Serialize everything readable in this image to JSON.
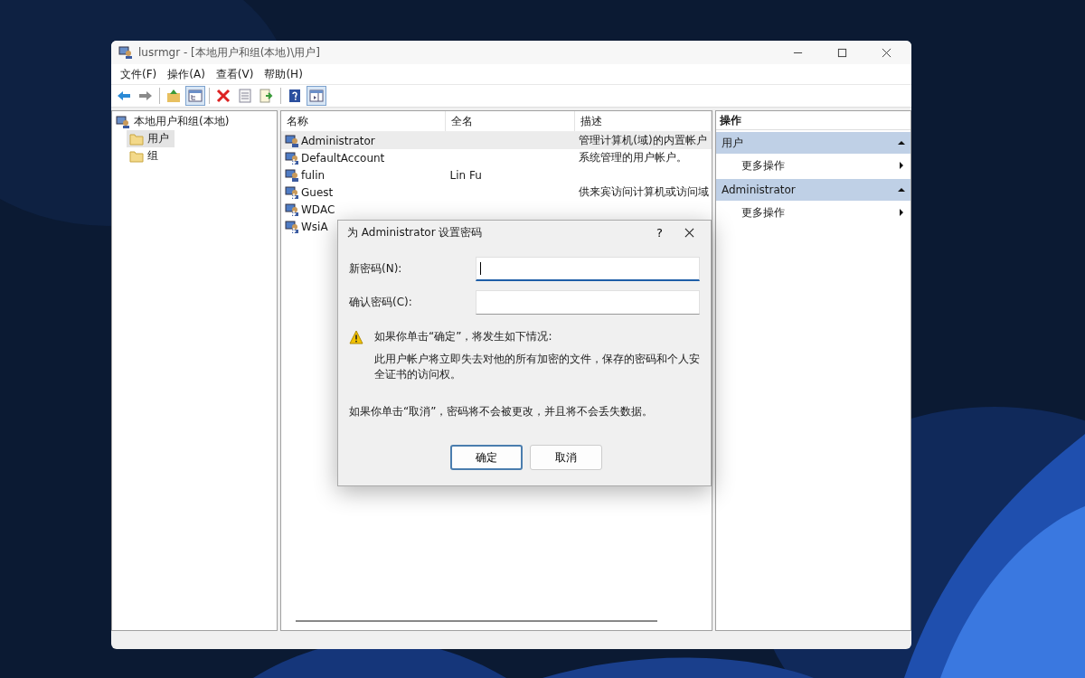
{
  "window": {
    "title": "lusrmgr - [本地用户和组(本地)\\用户]"
  },
  "menu": [
    "文件(F)",
    "操作(A)",
    "查看(V)",
    "帮助(H)"
  ],
  "toolbar": [
    {
      "kind": "back",
      "pressed": false
    },
    {
      "kind": "forward",
      "pressed": false
    },
    {
      "kind": "sep"
    },
    {
      "kind": "up",
      "pressed": false
    },
    {
      "kind": "tree",
      "pressed": true
    },
    {
      "kind": "sep"
    },
    {
      "kind": "delete",
      "pressed": false
    },
    {
      "kind": "properties",
      "pressed": false
    },
    {
      "kind": "export",
      "pressed": false
    },
    {
      "kind": "sep"
    },
    {
      "kind": "help",
      "pressed": false
    },
    {
      "kind": "pane",
      "pressed": true
    }
  ],
  "tree": {
    "label": "本地用户和组(本地)",
    "children": [
      {
        "label": "用户",
        "selected": true
      },
      {
        "label": "组",
        "selected": false
      }
    ]
  },
  "list": {
    "columns": [
      "名称",
      "全名",
      "描述"
    ],
    "rows": [
      {
        "name": "Administrator",
        "full_name": "",
        "description": "管理计算机(域)的内置帐户",
        "selected": true,
        "disabled": false
      },
      {
        "name": "DefaultAccount",
        "full_name": "",
        "description": "系统管理的用户帐户。",
        "selected": false,
        "disabled": true
      },
      {
        "name": "fulin",
        "full_name": "Lin Fu",
        "description": "",
        "selected": false,
        "disabled": false
      },
      {
        "name": "Guest",
        "full_name": "",
        "description": "供来宾访问计算机或访问域",
        "selected": false,
        "disabled": true
      },
      {
        "name": "WDAC",
        "full_name": "",
        "description": "",
        "selected": false,
        "disabled": true
      },
      {
        "name": "WsiA",
        "full_name": "",
        "description": "",
        "selected": false,
        "disabled": true
      }
    ]
  },
  "actions": {
    "title": "操作",
    "sections": [
      {
        "title": "用户",
        "expanded": true,
        "items": [
          "更多操作"
        ]
      },
      {
        "title": "Administrator",
        "expanded": true,
        "items": [
          "更多操作"
        ]
      }
    ]
  },
  "dialog": {
    "title": "为 Administrator 设置密码",
    "help": "?",
    "fields": [
      {
        "label": "新密码(N):",
        "focused": true
      },
      {
        "label": "确认密码(C):",
        "focused": false
      }
    ],
    "warning": "如果你单击“确定”，将发生如下情况:",
    "detail": "此用户帐户将立即失去对他的所有加密的文件，保存的密码和个人安全证书的访问权。",
    "note": "如果你单击“取消”，密码将不会被更改，并且将不会丢失数据。",
    "buttons": [
      {
        "label": "确定",
        "default": true
      },
      {
        "label": "取消",
        "default": false
      }
    ]
  }
}
